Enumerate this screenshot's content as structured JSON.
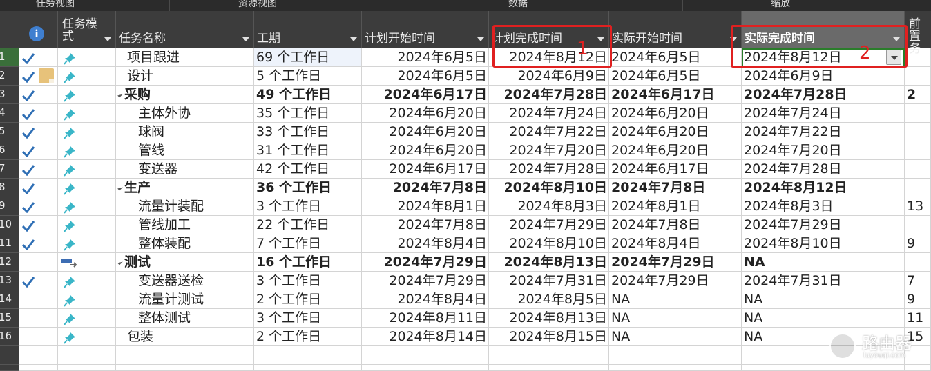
{
  "ribbon": {
    "groups": [
      "任务视图",
      "资源视图",
      "数据",
      "缩放"
    ]
  },
  "columns": {
    "mode": "任务模\n式",
    "name": "任务名称",
    "duration": "工期",
    "plan_start": "计划开始时间",
    "plan_finish": "计划完成时间",
    "actual_start": "实际开始时间",
    "actual_finish": "实际完成时间",
    "pred": "前置\n务"
  },
  "row_numbers": [
    "1",
    "2",
    "3",
    "4",
    "5",
    "6",
    "7",
    "8",
    "9",
    "10",
    "11",
    "12",
    "13",
    "14",
    "15",
    "16"
  ],
  "tasks": [
    {
      "check": true,
      "note": false,
      "mode": "auto",
      "name": "项目跟进",
      "level": 1,
      "summary": false,
      "duration": "69 个工作日",
      "plan_start": "2024年6月5日",
      "plan_finish": "2024年8月12日",
      "actual_start": "2024年6月5日",
      "actual_finish": "2024年8月12日",
      "pred": ""
    },
    {
      "check": true,
      "note": true,
      "mode": "auto",
      "name": "设计",
      "level": 1,
      "summary": false,
      "duration": "5 个工作日",
      "plan_start": "2024年6月5日",
      "plan_finish": "2024年6月9日",
      "actual_start": "2024年6月5日",
      "actual_finish": "2024年6月9日",
      "pred": ""
    },
    {
      "check": true,
      "note": false,
      "mode": "auto",
      "name": "采购",
      "level": 1,
      "summary": true,
      "duration": "49 个工作日",
      "plan_start": "2024年6月17日",
      "plan_finish": "2024年7月28日",
      "actual_start": "2024年6月17日",
      "actual_finish": "2024年7月28日",
      "pred": "2"
    },
    {
      "check": true,
      "note": false,
      "mode": "auto",
      "name": "主体外协",
      "level": 2,
      "summary": false,
      "duration": "35 个工作日",
      "plan_start": "2024年6月20日",
      "plan_finish": "2024年7月24日",
      "actual_start": "2024年6月20日",
      "actual_finish": "2024年7月24日",
      "pred": ""
    },
    {
      "check": true,
      "note": false,
      "mode": "auto",
      "name": "球阀",
      "level": 2,
      "summary": false,
      "duration": "33 个工作日",
      "plan_start": "2024年6月20日",
      "plan_finish": "2024年7月22日",
      "actual_start": "2024年6月20日",
      "actual_finish": "2024年7月22日",
      "pred": ""
    },
    {
      "check": true,
      "note": false,
      "mode": "auto",
      "name": "管线",
      "level": 2,
      "summary": false,
      "duration": "31 个工作日",
      "plan_start": "2024年6月20日",
      "plan_finish": "2024年7月20日",
      "actual_start": "2024年6月20日",
      "actual_finish": "2024年7月20日",
      "pred": ""
    },
    {
      "check": true,
      "note": false,
      "mode": "auto",
      "name": "变送器",
      "level": 2,
      "summary": false,
      "duration": "42 个工作日",
      "plan_start": "2024年6月17日",
      "plan_finish": "2024年7月28日",
      "actual_start": "2024年6月17日",
      "actual_finish": "2024年7月28日",
      "pred": ""
    },
    {
      "check": true,
      "note": false,
      "mode": "auto",
      "name": "生产",
      "level": 1,
      "summary": true,
      "duration": "36 个工作日",
      "plan_start": "2024年7月8日",
      "plan_finish": "2024年8月10日",
      "actual_start": "2024年7月8日",
      "actual_finish": "2024年8月12日",
      "pred": ""
    },
    {
      "check": true,
      "note": false,
      "mode": "auto",
      "name": "流量计装配",
      "level": 2,
      "summary": false,
      "duration": "3 个工作日",
      "plan_start": "2024年8月1日",
      "plan_finish": "2024年8月3日",
      "actual_start": "2024年8月1日",
      "actual_finish": "2024年8月3日",
      "pred": "13"
    },
    {
      "check": true,
      "note": false,
      "mode": "auto",
      "name": "管线加工",
      "level": 2,
      "summary": false,
      "duration": "22 个工作日",
      "plan_start": "2024年7月8日",
      "plan_finish": "2024年7月29日",
      "actual_start": "2024年7月8日",
      "actual_finish": "2024年7月29日",
      "pred": ""
    },
    {
      "check": true,
      "note": false,
      "mode": "auto",
      "name": "整体装配",
      "level": 2,
      "summary": false,
      "duration": "7 个工作日",
      "plan_start": "2024年8月4日",
      "plan_finish": "2024年8月10日",
      "actual_start": "2024年8月4日",
      "actual_finish": "2024年8月10日",
      "pred": "9"
    },
    {
      "check": false,
      "note": false,
      "mode": "manual",
      "name": "测试",
      "level": 1,
      "summary": true,
      "duration": "16 个工作日",
      "plan_start": "2024年7月29日",
      "plan_finish": "2024年8月13日",
      "actual_start": "2024年7月29日",
      "actual_finish": "NA",
      "pred": ""
    },
    {
      "check": true,
      "note": false,
      "mode": "auto",
      "name": "变送器送检",
      "level": 2,
      "summary": false,
      "duration": "3 个工作日",
      "plan_start": "2024年7月29日",
      "plan_finish": "2024年7月31日",
      "actual_start": "2024年7月29日",
      "actual_finish": "2024年7月31日",
      "pred": "7"
    },
    {
      "check": false,
      "note": false,
      "mode": "auto",
      "name": "流量计测试",
      "level": 2,
      "summary": false,
      "duration": "2 个工作日",
      "plan_start": "2024年8月4日",
      "plan_finish": "2024年8月5日",
      "actual_start": "NA",
      "actual_finish": "NA",
      "pred": "9"
    },
    {
      "check": false,
      "note": false,
      "mode": "auto",
      "name": "整体测试",
      "level": 2,
      "summary": false,
      "duration": "3 个工作日",
      "plan_start": "2024年8月11日",
      "plan_finish": "2024年8月13日",
      "actual_start": "NA",
      "actual_finish": "NA",
      "pred": "11"
    },
    {
      "check": false,
      "note": false,
      "mode": "auto",
      "name": "包装",
      "level": 1,
      "summary": false,
      "duration": "2 个工作日",
      "plan_start": "2024年8月14日",
      "plan_finish": "2024年8月15日",
      "actual_start": "NA",
      "actual_finish": "NA",
      "pred": "15"
    }
  ],
  "annotations": {
    "one": "1",
    "two": "2"
  },
  "watermark": {
    "title": "路由器",
    "sub": "luyouqi.com"
  },
  "colors": {
    "check": "#2f6fb5",
    "pin": "#3ab6c8",
    "highlight_box": "#e02020",
    "selected_cell": "#2a7d2a"
  }
}
